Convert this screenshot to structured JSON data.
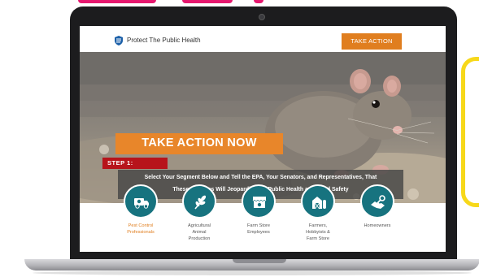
{
  "site": {
    "brand": "Protect The Public Health",
    "take_action_button": "TAKE ACTION"
  },
  "hero": {
    "headline": "TAKE ACTION NOW",
    "step_label": "STEP 1:",
    "instruction_line1": "Select Your Segment Below and Tell the EPA, Your Senators, and Representatives, That",
    "instruction_line2": "These Changes Will Jeopardize the Public Health and Food Safety"
  },
  "segments": [
    {
      "label_lines": [
        "Pest Control",
        "Professionals"
      ],
      "icon": "truck-icon",
      "active": true
    },
    {
      "label_lines": [
        "Agricultural",
        "Animal",
        "Production"
      ],
      "icon": "wheat-icon",
      "active": false
    },
    {
      "label_lines": [
        "Farm Store",
        "Employees"
      ],
      "icon": "storefront-icon",
      "active": false
    },
    {
      "label_lines": [
        "Farmers,",
        "Hobbyists &",
        "Farm Store"
      ],
      "icon": "barn-icon",
      "active": false
    },
    {
      "label_lines": [
        "Homeowners"
      ],
      "icon": "handshake-key-icon",
      "active": false
    }
  ],
  "colors": {
    "accent_orange": "#e07e1f",
    "step_red": "#b7141b",
    "icon_teal": "#17737f",
    "highlight_yellow": "#f7d81a",
    "heading_pink": "#e6186f"
  }
}
